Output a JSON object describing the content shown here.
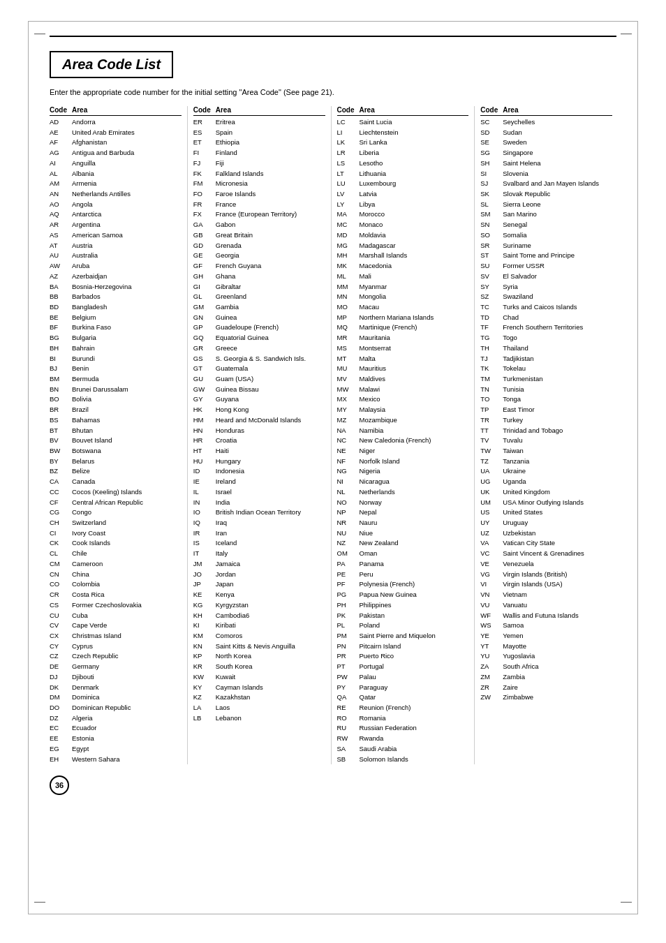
{
  "page": {
    "title": "Area Code List",
    "subtitle": "Enter the appropriate code number for the initial setting \"Area Code\" (See page 21).",
    "page_number": "36"
  },
  "columns": [
    {
      "header": {
        "code": "Code",
        "area": "Area"
      },
      "entries": [
        {
          "code": "AD",
          "area": "Andorra"
        },
        {
          "code": "AE",
          "area": "United Arab Emirates"
        },
        {
          "code": "AF",
          "area": "Afghanistan"
        },
        {
          "code": "AG",
          "area": "Antigua and Barbuda"
        },
        {
          "code": "AI",
          "area": "Anguilla"
        },
        {
          "code": "AL",
          "area": "Albania"
        },
        {
          "code": "AM",
          "area": "Armenia"
        },
        {
          "code": "AN",
          "area": "Netherlands Antilles"
        },
        {
          "code": "AO",
          "area": "Angola"
        },
        {
          "code": "AQ",
          "area": "Antarctica"
        },
        {
          "code": "AR",
          "area": "Argentina"
        },
        {
          "code": "AS",
          "area": "American Samoa"
        },
        {
          "code": "AT",
          "area": "Austria"
        },
        {
          "code": "AU",
          "area": "Australia"
        },
        {
          "code": "AW",
          "area": "Aruba"
        },
        {
          "code": "AZ",
          "area": "Azerbaidjan"
        },
        {
          "code": "BA",
          "area": "Bosnia-Herzegovina"
        },
        {
          "code": "BB",
          "area": "Barbados"
        },
        {
          "code": "BD",
          "area": "Bangladesh"
        },
        {
          "code": "BE",
          "area": "Belgium"
        },
        {
          "code": "BF",
          "area": "Burkina Faso"
        },
        {
          "code": "BG",
          "area": "Bulgaria"
        },
        {
          "code": "BH",
          "area": "Bahrain"
        },
        {
          "code": "BI",
          "area": "Burundi"
        },
        {
          "code": "BJ",
          "area": "Benin"
        },
        {
          "code": "BM",
          "area": "Bermuda"
        },
        {
          "code": "BN",
          "area": "Brunei Darussalam"
        },
        {
          "code": "BO",
          "area": "Bolivia"
        },
        {
          "code": "BR",
          "area": "Brazil"
        },
        {
          "code": "BS",
          "area": "Bahamas"
        },
        {
          "code": "BT",
          "area": "Bhutan"
        },
        {
          "code": "BV",
          "area": "Bouvet Island"
        },
        {
          "code": "BW",
          "area": "Botswana"
        },
        {
          "code": "BY",
          "area": "Belarus"
        },
        {
          "code": "BZ",
          "area": "Belize"
        },
        {
          "code": "CA",
          "area": "Canada"
        },
        {
          "code": "CC",
          "area": "Cocos (Keeling) Islands"
        },
        {
          "code": "CF",
          "area": "Central African Republic"
        },
        {
          "code": "CG",
          "area": "Congo"
        },
        {
          "code": "CH",
          "area": "Switzerland"
        },
        {
          "code": "CI",
          "area": "Ivory Coast"
        },
        {
          "code": "CK",
          "area": "Cook Islands"
        },
        {
          "code": "CL",
          "area": "Chile"
        },
        {
          "code": "CM",
          "area": "Cameroon"
        },
        {
          "code": "CN",
          "area": "China"
        },
        {
          "code": "CO",
          "area": "Colombia"
        },
        {
          "code": "CR",
          "area": "Costa Rica"
        },
        {
          "code": "CS",
          "area": "Former Czechoslovakia"
        },
        {
          "code": "CU",
          "area": "Cuba"
        },
        {
          "code": "CV",
          "area": "Cape Verde"
        },
        {
          "code": "CX",
          "area": "Christmas Island"
        },
        {
          "code": "CY",
          "area": "Cyprus"
        },
        {
          "code": "CZ",
          "area": "Czech Republic"
        },
        {
          "code": "DE",
          "area": "Germany"
        },
        {
          "code": "DJ",
          "area": "Djibouti"
        },
        {
          "code": "DK",
          "area": "Denmark"
        },
        {
          "code": "DM",
          "area": "Dominica"
        },
        {
          "code": "DO",
          "area": "Dominican Republic"
        },
        {
          "code": "DZ",
          "area": "Algeria"
        },
        {
          "code": "EC",
          "area": "Ecuador"
        },
        {
          "code": "EE",
          "area": "Estonia"
        },
        {
          "code": "EG",
          "area": "Egypt"
        },
        {
          "code": "EH",
          "area": "Western Sahara"
        }
      ]
    },
    {
      "header": {
        "code": "Code",
        "area": "Area"
      },
      "entries": [
        {
          "code": "ER",
          "area": "Eritrea"
        },
        {
          "code": "ES",
          "area": "Spain"
        },
        {
          "code": "ET",
          "area": "Ethiopia"
        },
        {
          "code": "FI",
          "area": "Finland"
        },
        {
          "code": "FJ",
          "area": "Fiji"
        },
        {
          "code": "FK",
          "area": "Falkland Islands"
        },
        {
          "code": "FM",
          "area": "Micronesia"
        },
        {
          "code": "FO",
          "area": "Faroe Islands"
        },
        {
          "code": "FR",
          "area": "France"
        },
        {
          "code": "FX",
          "area": "France (European Territory)"
        },
        {
          "code": "GA",
          "area": "Gabon"
        },
        {
          "code": "GB",
          "area": "Great Britain"
        },
        {
          "code": "GD",
          "area": "Grenada"
        },
        {
          "code": "GE",
          "area": "Georgia"
        },
        {
          "code": "GF",
          "area": "French Guyana"
        },
        {
          "code": "GH",
          "area": "Ghana"
        },
        {
          "code": "GI",
          "area": "Gibraltar"
        },
        {
          "code": "GL",
          "area": "Greenland"
        },
        {
          "code": "GM",
          "area": "Gambia"
        },
        {
          "code": "GN",
          "area": "Guinea"
        },
        {
          "code": "GP",
          "area": "Guadeloupe (French)"
        },
        {
          "code": "GQ",
          "area": "Equatorial Guinea"
        },
        {
          "code": "GR",
          "area": "Greece"
        },
        {
          "code": "GS",
          "area": "S. Georgia & S. Sandwich Isls."
        },
        {
          "code": "GT",
          "area": "Guatemala"
        },
        {
          "code": "GU",
          "area": "Guam (USA)"
        },
        {
          "code": "GW",
          "area": "Guinea Bissau"
        },
        {
          "code": "GY",
          "area": "Guyana"
        },
        {
          "code": "HK",
          "area": "Hong Kong"
        },
        {
          "code": "HM",
          "area": "Heard and McDonald Islands"
        },
        {
          "code": "HN",
          "area": "Honduras"
        },
        {
          "code": "HR",
          "area": "Croatia"
        },
        {
          "code": "HT",
          "area": "Haiti"
        },
        {
          "code": "HU",
          "area": "Hungary"
        },
        {
          "code": "ID",
          "area": "Indonesia"
        },
        {
          "code": "IE",
          "area": "Ireland"
        },
        {
          "code": "IL",
          "area": "Israel"
        },
        {
          "code": "IN",
          "area": "India"
        },
        {
          "code": "IO",
          "area": "British Indian Ocean Territory"
        },
        {
          "code": "IQ",
          "area": "Iraq"
        },
        {
          "code": "IR",
          "area": "Iran"
        },
        {
          "code": "IS",
          "area": "Iceland"
        },
        {
          "code": "IT",
          "area": "Italy"
        },
        {
          "code": "JM",
          "area": "Jamaica"
        },
        {
          "code": "JO",
          "area": "Jordan"
        },
        {
          "code": "JP",
          "area": "Japan"
        },
        {
          "code": "KE",
          "area": "Kenya"
        },
        {
          "code": "KG",
          "area": "Kyrgyzstan"
        },
        {
          "code": "KH",
          "area": "Cambodia6"
        },
        {
          "code": "KI",
          "area": "Kiribati"
        },
        {
          "code": "KM",
          "area": "Comoros"
        },
        {
          "code": "KN",
          "area": "Saint Kitts & Nevis Anguilla"
        },
        {
          "code": "KP",
          "area": "North Korea"
        },
        {
          "code": "KR",
          "area": "South Korea"
        },
        {
          "code": "KW",
          "area": "Kuwait"
        },
        {
          "code": "KY",
          "area": "Cayman Islands"
        },
        {
          "code": "KZ",
          "area": "Kazakhstan"
        },
        {
          "code": "LA",
          "area": "Laos"
        },
        {
          "code": "LB",
          "area": "Lebanon"
        }
      ]
    },
    {
      "header": {
        "code": "Code",
        "area": "Area"
      },
      "entries": [
        {
          "code": "LC",
          "area": "Saint Lucia"
        },
        {
          "code": "LI",
          "area": "Liechtenstein"
        },
        {
          "code": "LK",
          "area": "Sri Lanka"
        },
        {
          "code": "LR",
          "area": "Liberia"
        },
        {
          "code": "LS",
          "area": "Lesotho"
        },
        {
          "code": "LT",
          "area": "Lithuania"
        },
        {
          "code": "LU",
          "area": "Luxembourg"
        },
        {
          "code": "LV",
          "area": "Latvia"
        },
        {
          "code": "LY",
          "area": "Libya"
        },
        {
          "code": "MA",
          "area": "Morocco"
        },
        {
          "code": "MC",
          "area": "Monaco"
        },
        {
          "code": "MD",
          "area": "Moldavia"
        },
        {
          "code": "MG",
          "area": "Madagascar"
        },
        {
          "code": "MH",
          "area": "Marshall Islands"
        },
        {
          "code": "MK",
          "area": "Macedonia"
        },
        {
          "code": "ML",
          "area": "Mali"
        },
        {
          "code": "MM",
          "area": "Myanmar"
        },
        {
          "code": "MN",
          "area": "Mongolia"
        },
        {
          "code": "MO",
          "area": "Macau"
        },
        {
          "code": "MP",
          "area": "Northern Mariana Islands"
        },
        {
          "code": "MQ",
          "area": "Martinique (French)"
        },
        {
          "code": "MR",
          "area": "Mauritania"
        },
        {
          "code": "MS",
          "area": "Montserrat"
        },
        {
          "code": "MT",
          "area": "Malta"
        },
        {
          "code": "MU",
          "area": "Mauritius"
        },
        {
          "code": "MV",
          "area": "Maldives"
        },
        {
          "code": "MW",
          "area": "Malawi"
        },
        {
          "code": "MX",
          "area": "Mexico"
        },
        {
          "code": "MY",
          "area": "Malaysia"
        },
        {
          "code": "MZ",
          "area": "Mozambique"
        },
        {
          "code": "NA",
          "area": "Namibia"
        },
        {
          "code": "NC",
          "area": "New Caledonia (French)"
        },
        {
          "code": "NE",
          "area": "Niger"
        },
        {
          "code": "NF",
          "area": "Norfolk Island"
        },
        {
          "code": "NG",
          "area": "Nigeria"
        },
        {
          "code": "NI",
          "area": "Nicaragua"
        },
        {
          "code": "NL",
          "area": "Netherlands"
        },
        {
          "code": "NO",
          "area": "Norway"
        },
        {
          "code": "NP",
          "area": "Nepal"
        },
        {
          "code": "NR",
          "area": "Nauru"
        },
        {
          "code": "NU",
          "area": "Niue"
        },
        {
          "code": "NZ",
          "area": "New Zealand"
        },
        {
          "code": "OM",
          "area": "Oman"
        },
        {
          "code": "PA",
          "area": "Panama"
        },
        {
          "code": "PE",
          "area": "Peru"
        },
        {
          "code": "PF",
          "area": "Polynesia (French)"
        },
        {
          "code": "PG",
          "area": "Papua New Guinea"
        },
        {
          "code": "PH",
          "area": "Philippines"
        },
        {
          "code": "PK",
          "area": "Pakistan"
        },
        {
          "code": "PL",
          "area": "Poland"
        },
        {
          "code": "PM",
          "area": "Saint Pierre and Miquelon"
        },
        {
          "code": "PN",
          "area": "Pitcairn Island"
        },
        {
          "code": "PR",
          "area": "Puerto Rico"
        },
        {
          "code": "PT",
          "area": "Portugal"
        },
        {
          "code": "PW",
          "area": "Palau"
        },
        {
          "code": "PY",
          "area": "Paraguay"
        },
        {
          "code": "QA",
          "area": "Qatar"
        },
        {
          "code": "RE",
          "area": "Reunion (French)"
        },
        {
          "code": "RO",
          "area": "Romania"
        },
        {
          "code": "RU",
          "area": "Russian Federation"
        },
        {
          "code": "RW",
          "area": "Rwanda"
        },
        {
          "code": "SA",
          "area": "Saudi Arabia"
        },
        {
          "code": "SB",
          "area": "Solomon Islands"
        }
      ]
    },
    {
      "header": {
        "code": "Code",
        "area": "Area"
      },
      "entries": [
        {
          "code": "SC",
          "area": "Seychelles"
        },
        {
          "code": "SD",
          "area": "Sudan"
        },
        {
          "code": "SE",
          "area": "Sweden"
        },
        {
          "code": "SG",
          "area": "Singapore"
        },
        {
          "code": "SH",
          "area": "Saint Helena"
        },
        {
          "code": "SI",
          "area": "Slovenia"
        },
        {
          "code": "SJ",
          "area": "Svalbard and Jan Mayen Islands"
        },
        {
          "code": "SK",
          "area": "Slovak Republic"
        },
        {
          "code": "SL",
          "area": "Sierra Leone"
        },
        {
          "code": "SM",
          "area": "San Marino"
        },
        {
          "code": "SN",
          "area": "Senegal"
        },
        {
          "code": "SO",
          "area": "Somalia"
        },
        {
          "code": "SR",
          "area": "Suriname"
        },
        {
          "code": "ST",
          "area": "Saint Tome and Principe"
        },
        {
          "code": "SU",
          "area": "Former USSR"
        },
        {
          "code": "SV",
          "area": "El Salvador"
        },
        {
          "code": "SY",
          "area": "Syria"
        },
        {
          "code": "SZ",
          "area": "Swaziland"
        },
        {
          "code": "TC",
          "area": "Turks and Caicos Islands"
        },
        {
          "code": "TD",
          "area": "Chad"
        },
        {
          "code": "TF",
          "area": "French Southern Territories"
        },
        {
          "code": "TG",
          "area": "Togo"
        },
        {
          "code": "TH",
          "area": "Thailand"
        },
        {
          "code": "TJ",
          "area": "Tadjikistan"
        },
        {
          "code": "TK",
          "area": "Tokelau"
        },
        {
          "code": "TM",
          "area": "Turkmenistan"
        },
        {
          "code": "TN",
          "area": "Tunisia"
        },
        {
          "code": "TO",
          "area": "Tonga"
        },
        {
          "code": "TP",
          "area": "East Timor"
        },
        {
          "code": "TR",
          "area": "Turkey"
        },
        {
          "code": "TT",
          "area": "Trinidad and Tobago"
        },
        {
          "code": "TV",
          "area": "Tuvalu"
        },
        {
          "code": "TW",
          "area": "Taiwan"
        },
        {
          "code": "TZ",
          "area": "Tanzania"
        },
        {
          "code": "UA",
          "area": "Ukraine"
        },
        {
          "code": "UG",
          "area": "Uganda"
        },
        {
          "code": "UK",
          "area": "United Kingdom"
        },
        {
          "code": "UM",
          "area": "USA Minor Outlying Islands"
        },
        {
          "code": "US",
          "area": "United States"
        },
        {
          "code": "UY",
          "area": "Uruguay"
        },
        {
          "code": "UZ",
          "area": "Uzbekistan"
        },
        {
          "code": "VA",
          "area": "Vatican City State"
        },
        {
          "code": "VC",
          "area": "Saint Vincent & Grenadines"
        },
        {
          "code": "VE",
          "area": "Venezuela"
        },
        {
          "code": "VG",
          "area": "Virgin Islands (British)"
        },
        {
          "code": "VI",
          "area": "Virgin Islands (USA)"
        },
        {
          "code": "VN",
          "area": "Vietnam"
        },
        {
          "code": "VU",
          "area": "Vanuatu"
        },
        {
          "code": "WF",
          "area": "Wallis and Futuna Islands"
        },
        {
          "code": "WS",
          "area": "Samoa"
        },
        {
          "code": "YE",
          "area": "Yemen"
        },
        {
          "code": "YT",
          "area": "Mayotte"
        },
        {
          "code": "YU",
          "area": "Yugoslavia"
        },
        {
          "code": "ZA",
          "area": "South Africa"
        },
        {
          "code": "ZM",
          "area": "Zambia"
        },
        {
          "code": "ZR",
          "area": "Zaire"
        },
        {
          "code": "ZW",
          "area": "Zimbabwe"
        }
      ]
    }
  ]
}
